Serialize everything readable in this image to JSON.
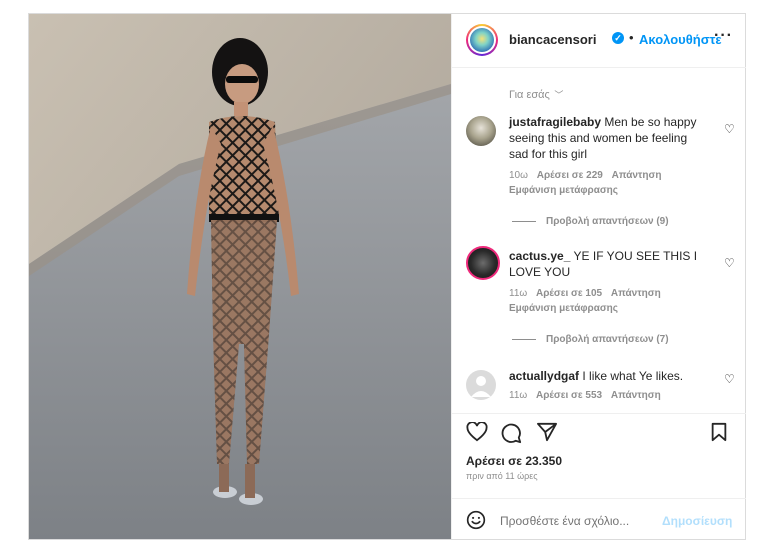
{
  "post": {
    "username": "biancacensori",
    "dot": "•",
    "follow_label": "Ακολουθήστε",
    "more_label": "···",
    "for_you_label": "Για εσάς",
    "likes": "Αρέσει σε 23.350",
    "posted_time": "πριν από 11 ώρες",
    "add_comment_placeholder": "Προσθέστε ένα σχόλιο...",
    "post_button": "Δημοσίευση"
  },
  "comments": [
    {
      "user": "justafragilebaby",
      "text": "Men be so happy seeing this and women be feeling sad for this girl",
      "age": "10ω",
      "likes": "Αρέσει σε 229",
      "reply": "Απάντηση",
      "translate": "Εμφάνιση μετάφρασης",
      "view_replies": "Προβολή απαντήσεων (9)"
    },
    {
      "user": "cactus.ye_",
      "text": "YE IF YOU SEE THIS I LOVE YOU",
      "age": "11ω",
      "likes": "Αρέσει σε 105",
      "reply": "Απάντηση",
      "translate": "Εμφάνιση μετάφρασης",
      "view_replies": "Προβολή απαντήσεων (7)"
    },
    {
      "user": "actuallydgaf",
      "text": "I like what Ye likes.",
      "age": "11ω",
      "likes": "Αρέσει σε 553",
      "reply": "Απάντηση"
    }
  ],
  "icons": {
    "verified": "verified-badge-icon",
    "like": "heart-icon",
    "comment": "comment-bubble-icon",
    "share": "paper-plane-icon",
    "save": "bookmark-icon",
    "emoji": "emoji-icon"
  },
  "colors": {
    "accent": "#0095f6",
    "muted": "#8e8e8e",
    "post_disabled": "#b2dffc"
  }
}
